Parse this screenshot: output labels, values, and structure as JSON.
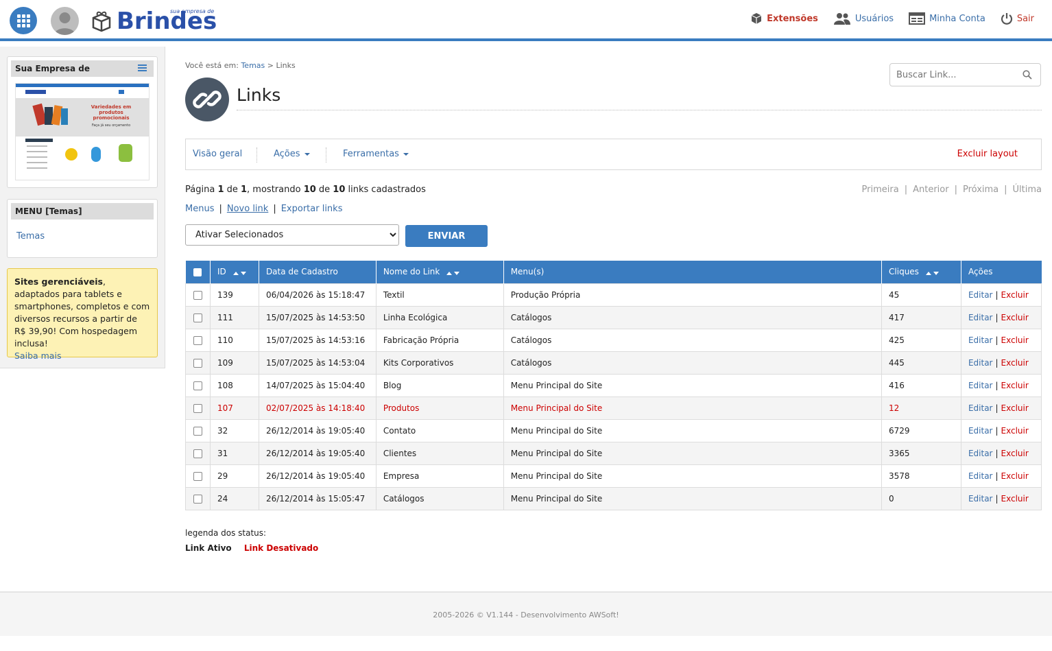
{
  "header": {
    "brand": "Brindes",
    "brand_tag": "sua empresa de",
    "nav": [
      {
        "label": "Extensões",
        "icon": "cube-icon"
      },
      {
        "label": "Usuários",
        "icon": "users-icon"
      },
      {
        "label": "Minha Conta",
        "icon": "account-icon"
      },
      {
        "label": "Sair",
        "icon": "power-icon"
      }
    ]
  },
  "sidebar": {
    "site_box_title": "Sua Empresa de",
    "menu_box_title": "MENU [Temas]",
    "menu_item": "Temas",
    "promo": {
      "bold": "Sites gerenciáveis",
      "text": ", adaptados para tablets e smartphones, completos e com diversos recursos a partir de R$ 39,90! Com hospedagem inclusa!",
      "link": "Saiba mais"
    },
    "thumb": {
      "headline": "Variedades em produtos promocionais",
      "sub": "Faça já seu orçamento"
    }
  },
  "breadcrumb": {
    "prefix": "Você está em:",
    "link": "Temas",
    "sep": ">",
    "current": "Links"
  },
  "page_title": "Links",
  "search": {
    "placeholder": "Buscar Link..."
  },
  "toolbar": {
    "overview": "Visão geral",
    "actions": "Ações",
    "tools": "Ferramentas",
    "delete_layout": "Excluir layout"
  },
  "paging": {
    "t1": "Página ",
    "page": "1",
    "t2": " de ",
    "pages": "1",
    "t3": ", mostrando ",
    "shown": "10",
    "t4": " de ",
    "total": "10",
    "t5": " links cadastrados"
  },
  "pager": {
    "first": "Primeira",
    "prev": "Anterior",
    "next": "Próxima",
    "last": "Última",
    "sep": "|"
  },
  "links": {
    "menus": "Menus",
    "new": "Novo link",
    "export": "Exportar links",
    "sep": "|"
  },
  "bulk": {
    "selected": "Ativar Selecionados",
    "send": "ENVIAR"
  },
  "table": {
    "headers": [
      "ID",
      "Data de Cadastro",
      "Nome do Link",
      "Menu(s)",
      "Cliques",
      "Ações"
    ],
    "edit": "Editar",
    "delete": "Excluir",
    "act_sep": "|",
    "rows": [
      {
        "id": "139",
        "date": "06/04/2026 às 15:18:47",
        "name": "Textil",
        "menu": "Produção Própria",
        "clicks": "45",
        "active": true
      },
      {
        "id": "111",
        "date": "15/07/2025 às 14:53:50",
        "name": "Linha Ecológica",
        "menu": "Catálogos",
        "clicks": "417",
        "active": true
      },
      {
        "id": "110",
        "date": "15/07/2025 às 14:53:16",
        "name": "Fabricação Própria",
        "menu": "Catálogos",
        "clicks": "425",
        "active": true
      },
      {
        "id": "109",
        "date": "15/07/2025 às 14:53:04",
        "name": "Kits Corporativos",
        "menu": "Catálogos",
        "clicks": "445",
        "active": true
      },
      {
        "id": "108",
        "date": "14/07/2025 às 15:04:40",
        "name": "Blog",
        "menu": "Menu Principal do Site",
        "clicks": "416",
        "active": true
      },
      {
        "id": "107",
        "date": "02/07/2025 às 14:18:40",
        "name": "Produtos",
        "menu": "Menu Principal do Site",
        "clicks": "12",
        "active": false
      },
      {
        "id": "32",
        "date": "26/12/2014 às 19:05:40",
        "name": "Contato",
        "menu": "Menu Principal do Site",
        "clicks": "6729",
        "active": true
      },
      {
        "id": "31",
        "date": "26/12/2014 às 19:05:40",
        "name": "Clientes",
        "menu": "Menu Principal do Site",
        "clicks": "3365",
        "active": true
      },
      {
        "id": "29",
        "date": "26/12/2014 às 19:05:40",
        "name": "Empresa",
        "menu": "Menu Principal do Site",
        "clicks": "3578",
        "active": true
      },
      {
        "id": "24",
        "date": "26/12/2014 às 15:05:47",
        "name": "Catálogos",
        "menu": "Menu Principal do Site",
        "clicks": "0",
        "active": true
      }
    ]
  },
  "legend": {
    "title": "legenda dos status:",
    "active": "Link Ativo",
    "inactive": "Link Desativado"
  },
  "footer": "2005-2026 © V1.144 - Desenvolvimento AWSoft!",
  "colors": {
    "accent": "#3a7cc0",
    "danger": "#cc0000",
    "link": "#3a6ea8",
    "promo_bg": "#fdf2b5"
  }
}
